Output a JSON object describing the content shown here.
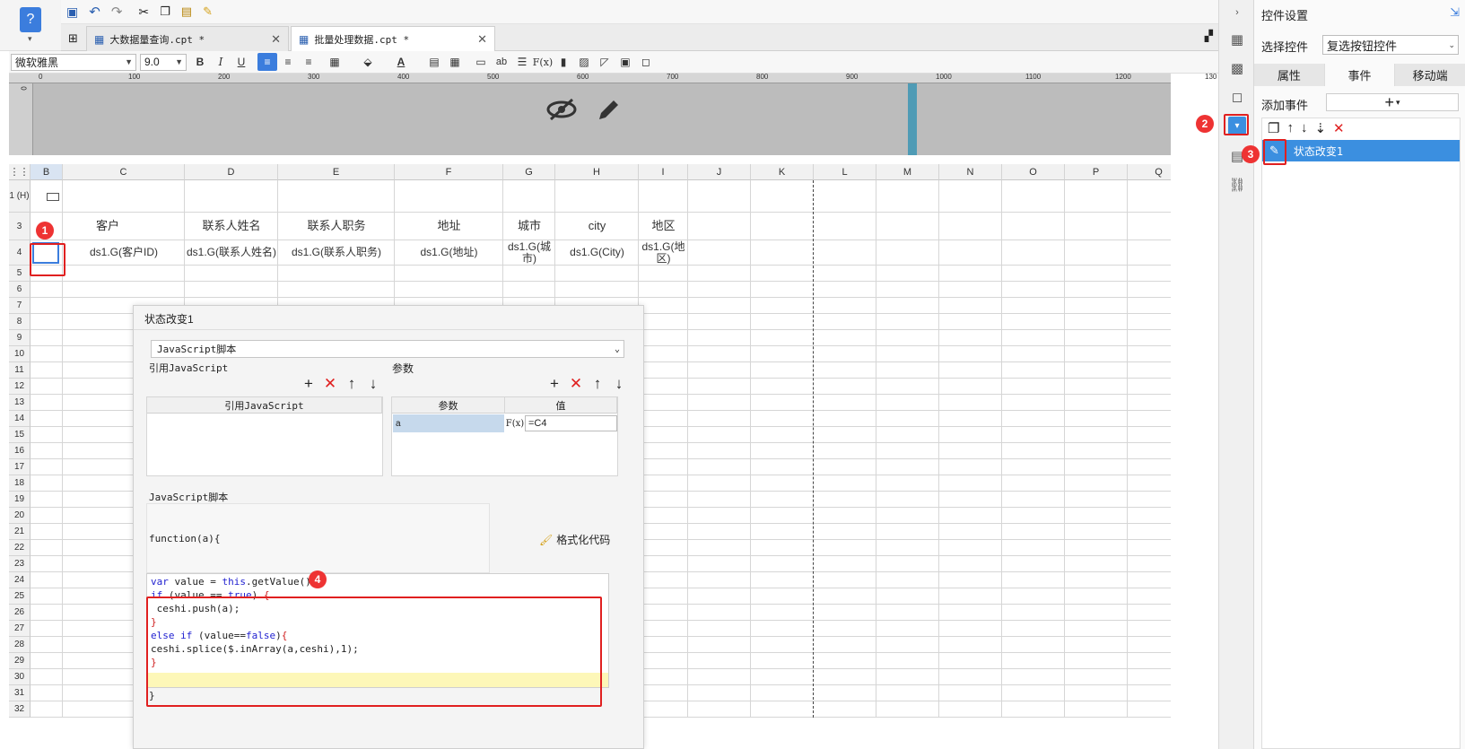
{
  "tabs": [
    {
      "label": "大数据量查询.cpt *"
    },
    {
      "label": "批量处理数据.cpt *"
    }
  ],
  "format": {
    "font": "微软雅黑",
    "size": "9.0"
  },
  "ruler": {
    "ticks": [
      "0",
      "100",
      "200",
      "300",
      "400",
      "500",
      "600",
      "700",
      "800",
      "900",
      "1000",
      "1100",
      "1200",
      "130"
    ],
    "vtick": "0"
  },
  "sheet": {
    "cols": [
      "B",
      "C",
      "D",
      "E",
      "F",
      "G",
      "H",
      "I",
      "J",
      "K",
      "L",
      "M",
      "N",
      "O",
      "P",
      "Q"
    ],
    "rows": [
      "1 (H)",
      "3",
      "4",
      "5",
      "6",
      "7",
      "8",
      "9",
      "10",
      "11",
      "12",
      "13",
      "14",
      "15",
      "16",
      "17",
      "18",
      "19",
      "20",
      "21",
      "22",
      "23",
      "24",
      "25",
      "26",
      "27",
      "28",
      "29",
      "30",
      "31",
      "32"
    ],
    "headers": [
      "客户",
      "联系人姓名",
      "联系人职务",
      "地址",
      "城市",
      "city",
      "地区"
    ],
    "values": [
      "ds1.G(客户ID)",
      "ds1.G(联系人姓名)",
      "ds1.G(联系人职务)",
      "ds1.G(地址)",
      "ds1.G(城市)",
      "ds1.G(City)",
      "ds1.G(地区)"
    ]
  },
  "panel": {
    "title": "控件设置",
    "select_label": "选择控件",
    "select_value": "复选按钮控件",
    "tabs": [
      "属性",
      "事件",
      "移动端"
    ],
    "add_event": "添加事件",
    "event_item": "状态改变1"
  },
  "dialog": {
    "title": "状态改变1",
    "type": "JavaScript脚本",
    "ref_js_label": "引用JavaScript",
    "ref_js_header": "引用JavaScript",
    "params_label": "参数",
    "param_col": "参数",
    "value_col": "值",
    "param_name": "a",
    "param_value": "=C4",
    "script_label": "JavaScript脚本",
    "func_head": "function(a){",
    "format_btn": "格式化代码",
    "close_brace": "}"
  },
  "badges": [
    "1",
    "2",
    "3",
    "4"
  ],
  "colors": {
    "accent": "#3b7ddd",
    "annotation": "#e02020",
    "selected": "#3b8fe0"
  }
}
